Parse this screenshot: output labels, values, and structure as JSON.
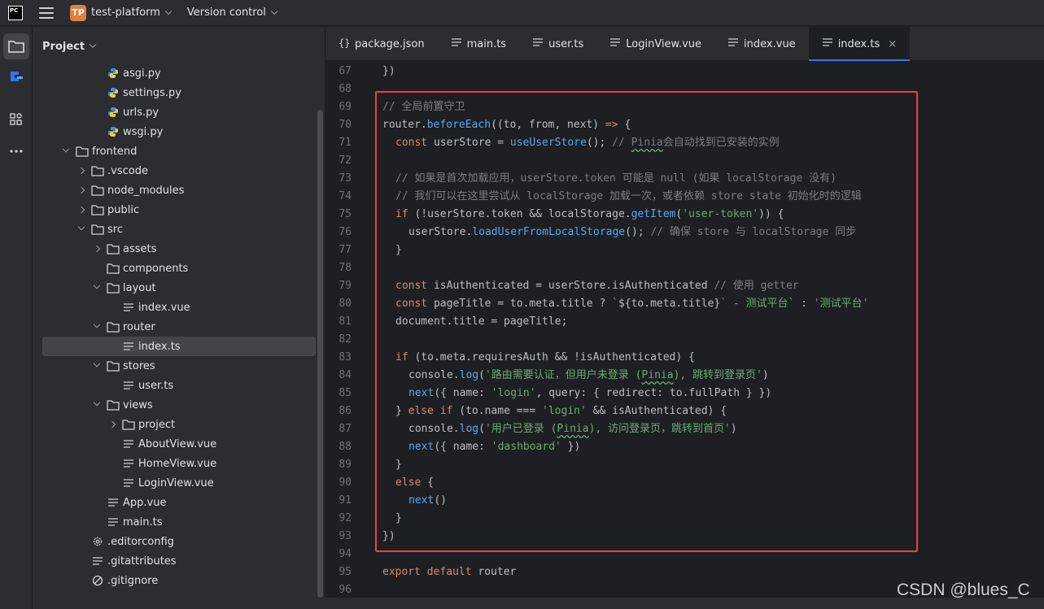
{
  "titlebar": {
    "logo_lines": [
      "PC",
      "_"
    ],
    "project_badge": "TP",
    "project_name": "test-platform",
    "vcs_label": "Version control"
  },
  "project_panel": {
    "title": "Project",
    "tree": [
      {
        "label": "asgi.py",
        "icon": "python-file-icon",
        "depth": 3,
        "arrow": "none"
      },
      {
        "label": "settings.py",
        "icon": "python-file-icon",
        "depth": 3,
        "arrow": "none"
      },
      {
        "label": "urls.py",
        "icon": "python-file-icon",
        "depth": 3,
        "arrow": "none"
      },
      {
        "label": "wsgi.py",
        "icon": "python-file-icon",
        "depth": 3,
        "arrow": "none"
      },
      {
        "label": "frontend",
        "icon": "folder-icon",
        "depth": 1,
        "arrow": "open"
      },
      {
        "label": ".vscode",
        "icon": "folder-icon",
        "depth": 2,
        "arrow": "closed"
      },
      {
        "label": "node_modules",
        "icon": "folder-icon",
        "depth": 2,
        "arrow": "closed"
      },
      {
        "label": "public",
        "icon": "folder-icon",
        "depth": 2,
        "arrow": "closed"
      },
      {
        "label": "src",
        "icon": "folder-icon",
        "depth": 2,
        "arrow": "open"
      },
      {
        "label": "assets",
        "icon": "folder-icon",
        "depth": 3,
        "arrow": "closed"
      },
      {
        "label": "components",
        "icon": "folder-icon",
        "depth": 3,
        "arrow": "none"
      },
      {
        "label": "layout",
        "icon": "folder-icon",
        "depth": 3,
        "arrow": "open"
      },
      {
        "label": "index.vue",
        "icon": "text-file-icon",
        "depth": 4,
        "arrow": "none"
      },
      {
        "label": "router",
        "icon": "folder-icon",
        "depth": 3,
        "arrow": "open"
      },
      {
        "label": "index.ts",
        "icon": "text-file-icon",
        "depth": 4,
        "arrow": "none",
        "selected": true
      },
      {
        "label": "stores",
        "icon": "folder-icon",
        "depth": 3,
        "arrow": "open"
      },
      {
        "label": "user.ts",
        "icon": "text-file-icon",
        "depth": 4,
        "arrow": "none"
      },
      {
        "label": "views",
        "icon": "folder-icon",
        "depth": 3,
        "arrow": "open"
      },
      {
        "label": "project",
        "icon": "folder-icon",
        "depth": 4,
        "arrow": "closed"
      },
      {
        "label": "AboutView.vue",
        "icon": "text-file-icon",
        "depth": 4,
        "arrow": "none"
      },
      {
        "label": "HomeView.vue",
        "icon": "text-file-icon",
        "depth": 4,
        "arrow": "none"
      },
      {
        "label": "LoginView.vue",
        "icon": "text-file-icon",
        "depth": 4,
        "arrow": "none"
      },
      {
        "label": "App.vue",
        "icon": "text-file-icon",
        "depth": 3,
        "arrow": "none"
      },
      {
        "label": "main.ts",
        "icon": "text-file-icon",
        "depth": 3,
        "arrow": "none"
      },
      {
        "label": ".editorconfig",
        "icon": "gear-icon",
        "depth": 2,
        "arrow": "none"
      },
      {
        "label": ".gitattributes",
        "icon": "text-file-icon",
        "depth": 2,
        "arrow": "none"
      },
      {
        "label": ".gitignore",
        "icon": "ignore-file-icon",
        "depth": 2,
        "arrow": "none"
      }
    ]
  },
  "tabs": [
    {
      "label": "package.json",
      "icon": "json-file-icon"
    },
    {
      "label": "main.ts",
      "icon": "text-file-icon"
    },
    {
      "label": "user.ts",
      "icon": "text-file-icon"
    },
    {
      "label": "LoginView.vue",
      "icon": "text-file-icon"
    },
    {
      "label": "index.vue",
      "icon": "text-file-icon"
    },
    {
      "label": "index.ts",
      "icon": "text-file-icon",
      "active": true,
      "close": "×"
    }
  ],
  "code_lines": [
    {
      "n": "67",
      "indent": 0,
      "tokens": [
        [
          "tx",
          "})"
        ]
      ]
    },
    {
      "n": "68",
      "indent": 0,
      "tokens": []
    },
    {
      "n": "69",
      "indent": 0,
      "tokens": [
        [
          "cm",
          "// 全局前置守卫"
        ]
      ]
    },
    {
      "n": "70",
      "indent": 0,
      "tokens": [
        [
          "tx",
          "router."
        ],
        [
          "fn",
          "beforeEach"
        ],
        [
          "tx",
          "((to, from, next) "
        ],
        [
          "kw",
          "=>"
        ],
        [
          "tx",
          " {"
        ]
      ]
    },
    {
      "n": "71",
      "indent": 1,
      "tokens": [
        [
          "kw",
          "const "
        ],
        [
          "tx",
          "userStore = "
        ],
        [
          "fn",
          "useUserStore"
        ],
        [
          "tx",
          "(); "
        ],
        [
          "cm",
          "// "
        ],
        [
          "cmu",
          "Pinia"
        ],
        [
          "cm",
          "会自动找到已安装的实例"
        ]
      ]
    },
    {
      "n": "72",
      "indent": 0,
      "tokens": []
    },
    {
      "n": "73",
      "indent": 1,
      "tokens": [
        [
          "cm",
          "// 如果是首次加载应用，userStore.token 可能是 null (如果 localStorage 没有)"
        ]
      ]
    },
    {
      "n": "74",
      "indent": 1,
      "tokens": [
        [
          "cm",
          "// 我们可以在这里尝试从 localStorage 加载一次，或者依赖 store state 初始化时的逻辑"
        ]
      ]
    },
    {
      "n": "75",
      "indent": 1,
      "tokens": [
        [
          "kw",
          "if "
        ],
        [
          "tx",
          "(!userStore.token && localStorage."
        ],
        [
          "fn",
          "getItem"
        ],
        [
          "tx",
          "("
        ],
        [
          "str",
          "'user-token'"
        ],
        [
          "tx",
          ")) {"
        ]
      ]
    },
    {
      "n": "76",
      "indent": 2,
      "tokens": [
        [
          "tx",
          "userStore."
        ],
        [
          "fn",
          "loadUserFromLocalStorage"
        ],
        [
          "tx",
          "(); "
        ],
        [
          "cm",
          "// 确保 store 与 localStorage 同步"
        ]
      ]
    },
    {
      "n": "77",
      "indent": 1,
      "tokens": [
        [
          "tx",
          "}"
        ]
      ]
    },
    {
      "n": "78",
      "indent": 0,
      "tokens": []
    },
    {
      "n": "79",
      "indent": 1,
      "tokens": [
        [
          "kw",
          "const "
        ],
        [
          "tx",
          "isAuthenticated = userStore.isAuthenticated "
        ],
        [
          "cm",
          "// 使用 getter"
        ]
      ]
    },
    {
      "n": "80",
      "indent": 1,
      "tokens": [
        [
          "kw",
          "const "
        ],
        [
          "tx",
          "pageTitle = to.meta.title ? "
        ],
        [
          "str",
          "`"
        ],
        [
          "tx",
          "${to.meta.title}"
        ],
        [
          "str",
          "` - 测试平台` "
        ],
        [
          "tx",
          ": "
        ],
        [
          "str",
          "'测试平台'"
        ]
      ]
    },
    {
      "n": "81",
      "indent": 1,
      "tokens": [
        [
          "tx",
          "document.title = pageTitle;"
        ]
      ]
    },
    {
      "n": "82",
      "indent": 0,
      "tokens": []
    },
    {
      "n": "83",
      "indent": 1,
      "tokens": [
        [
          "kw",
          "if "
        ],
        [
          "tx",
          "(to.meta.requiresAuth && !isAuthenticated) {"
        ]
      ]
    },
    {
      "n": "84",
      "indent": 2,
      "tokens": [
        [
          "tx",
          "console."
        ],
        [
          "fn",
          "log"
        ],
        [
          "tx",
          "("
        ],
        [
          "str",
          "'路由需要认证，但用户未登录 ("
        ],
        [
          "stru",
          "Pinia"
        ],
        [
          "str",
          "), 跳转到登录页'"
        ],
        [
          "tx",
          ")"
        ]
      ]
    },
    {
      "n": "85",
      "indent": 2,
      "tokens": [
        [
          "fn",
          "next"
        ],
        [
          "tx",
          "({ name: "
        ],
        [
          "str",
          "'login'"
        ],
        [
          "tx",
          ", query: { redirect: to.fullPath } })"
        ]
      ]
    },
    {
      "n": "86",
      "indent": 1,
      "tokens": [
        [
          "tx",
          "} "
        ],
        [
          "kw",
          "else if "
        ],
        [
          "tx",
          "(to.name === "
        ],
        [
          "str",
          "'login'"
        ],
        [
          "tx",
          " && isAuthenticated) {"
        ]
      ]
    },
    {
      "n": "87",
      "indent": 2,
      "tokens": [
        [
          "tx",
          "console."
        ],
        [
          "fn",
          "log"
        ],
        [
          "tx",
          "("
        ],
        [
          "str",
          "'用户已登录 ("
        ],
        [
          "stru",
          "Pinia"
        ],
        [
          "str",
          "), 访问登录页，跳转到首页'"
        ],
        [
          "tx",
          ")"
        ]
      ]
    },
    {
      "n": "88",
      "indent": 2,
      "tokens": [
        [
          "fn",
          "next"
        ],
        [
          "tx",
          "({ name: "
        ],
        [
          "str",
          "'dashboard'"
        ],
        [
          "tx",
          " })"
        ]
      ]
    },
    {
      "n": "89",
      "indent": 1,
      "tokens": [
        [
          "tx",
          "}"
        ]
      ]
    },
    {
      "n": "90",
      "indent": 1,
      "tokens": [
        [
          "kw",
          "else "
        ],
        [
          "tx",
          "{"
        ]
      ]
    },
    {
      "n": "91",
      "indent": 2,
      "tokens": [
        [
          "fn",
          "next"
        ],
        [
          "tx",
          "()"
        ]
      ]
    },
    {
      "n": "92",
      "indent": 1,
      "tokens": [
        [
          "tx",
          "}"
        ]
      ]
    },
    {
      "n": "93",
      "indent": 0,
      "tokens": [
        [
          "tx",
          "})"
        ]
      ]
    },
    {
      "n": "94",
      "indent": 0,
      "tokens": []
    },
    {
      "n": "95",
      "indent": 0,
      "tokens": [
        [
          "kw",
          "export default "
        ],
        [
          "tx",
          "router"
        ]
      ]
    },
    {
      "n": "96",
      "indent": 0,
      "tokens": []
    }
  ],
  "watermark": "CSDN @blues_C",
  "colors": {
    "highlight_box": "#e8453c",
    "accent": "#3574f0"
  }
}
